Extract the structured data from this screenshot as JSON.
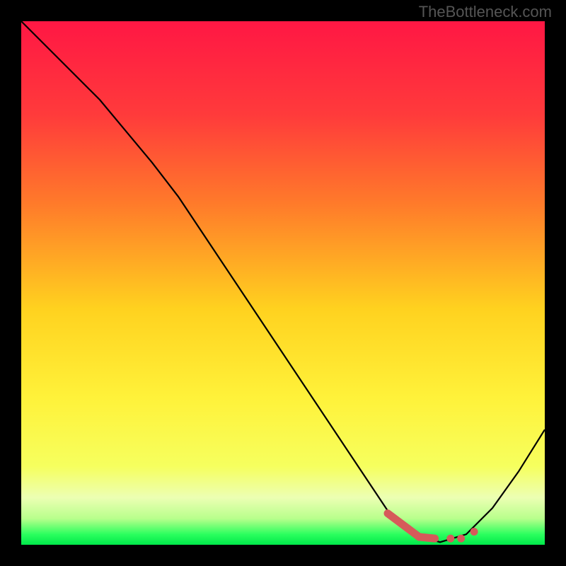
{
  "watermark": "TheBottleneck.com",
  "chart_data": {
    "type": "line",
    "title": "",
    "xlabel": "",
    "ylabel": "",
    "xlim": [
      0,
      100
    ],
    "ylim": [
      0,
      100
    ],
    "x": [
      0,
      5,
      10,
      15,
      20,
      25,
      30,
      35,
      40,
      45,
      50,
      55,
      60,
      65,
      70,
      75,
      80,
      85,
      90,
      95,
      100
    ],
    "values": [
      100,
      95,
      90,
      85,
      79,
      73,
      66.5,
      59,
      51.5,
      44,
      36.5,
      29,
      21.5,
      14,
      6.5,
      2,
      0.5,
      2,
      7,
      14,
      22
    ],
    "curve_notes": "V-shaped bottleneck curve with slight slope change around x=25; minimum near x=80",
    "markers": {
      "type": "accent-segment-and-dots",
      "color": "#d65a5a",
      "segments": [
        {
          "x_start": 70,
          "x_end": 76,
          "y_start": 6,
          "y_end": 1.5
        },
        {
          "x_start": 76,
          "x_end": 79,
          "y_start": 1.5,
          "y_end": 1.2
        }
      ],
      "dots": [
        {
          "x": 82,
          "y": 1.2
        },
        {
          "x": 84,
          "y": 1.2
        },
        {
          "x": 86.5,
          "y": 2.5
        }
      ]
    },
    "background_gradient": {
      "type": "vertical",
      "stops": [
        {
          "pos": 0.0,
          "color": "#ff1744"
        },
        {
          "pos": 0.18,
          "color": "#ff3b3b"
        },
        {
          "pos": 0.35,
          "color": "#ff7b2a"
        },
        {
          "pos": 0.55,
          "color": "#ffd21f"
        },
        {
          "pos": 0.72,
          "color": "#fff23a"
        },
        {
          "pos": 0.85,
          "color": "#f6ff5e"
        },
        {
          "pos": 0.91,
          "color": "#ecffb3"
        },
        {
          "pos": 0.95,
          "color": "#b8ff8c"
        },
        {
          "pos": 0.98,
          "color": "#2bff5e"
        },
        {
          "pos": 1.0,
          "color": "#00e84a"
        }
      ]
    }
  }
}
